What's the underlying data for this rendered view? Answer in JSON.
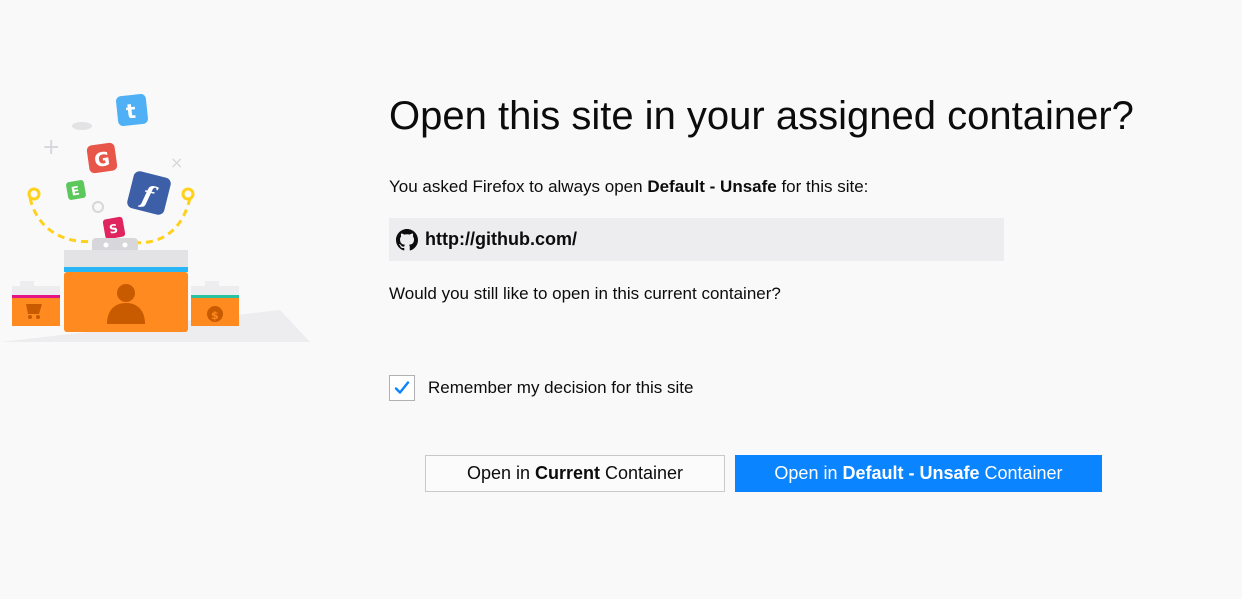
{
  "dialog": {
    "title": "Open this site in your assigned container?",
    "intro_prefix": "You asked Firefox to always open ",
    "container_name": "Default - Unsafe",
    "intro_suffix": " for this site:",
    "url": "http://github.com/",
    "url_icon": "github-icon",
    "question": "Would you still like to open in this current container?",
    "remember_label": "Remember my decision for this site",
    "remember_checked": true
  },
  "buttons": {
    "current": {
      "prefix": "Open in ",
      "bold": "Current",
      "suffix": " Container"
    },
    "default": {
      "prefix": "Open in ",
      "bold": "Default - Unsafe",
      "suffix": " Container"
    }
  },
  "illustration": {
    "app_tiles": [
      "t",
      "G",
      "E",
      "f",
      "S"
    ]
  },
  "colors": {
    "primary_button": "#0a84ff",
    "container_orange": "#ff8a1f",
    "accent_blue": "#29b6f6",
    "dashed_line": "#ffd11a"
  }
}
